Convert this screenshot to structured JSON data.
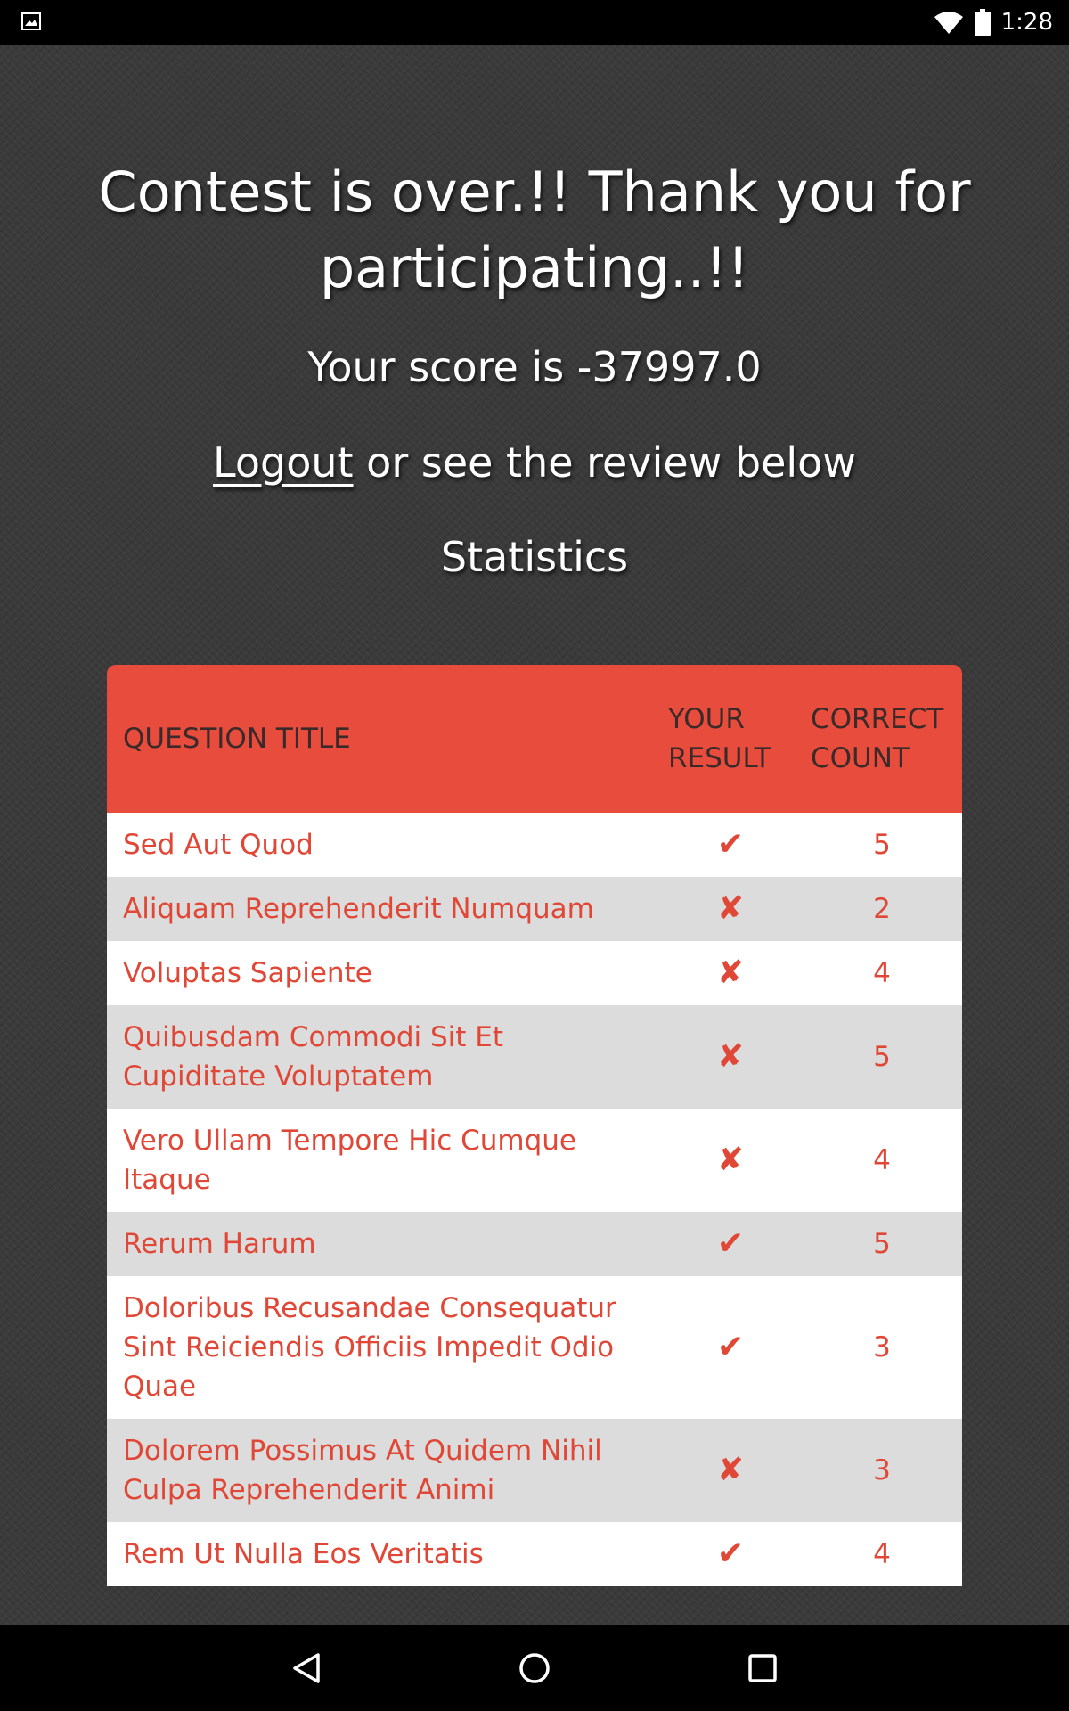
{
  "status_bar": {
    "time": "1:28",
    "left_icon": "image-icon",
    "icons": [
      "wifi-icon",
      "battery-icon"
    ]
  },
  "page": {
    "headline": "Contest is over.!! Thank you for participating..!!",
    "score_text": "Your score is -37997.0",
    "logout_label": "Logout",
    "review_text": " or see the review below",
    "statistics_title": "Statistics"
  },
  "table": {
    "headers": {
      "question_title": "QUESTION TITLE",
      "your_result": "YOUR RESULT",
      "correct_count": "CORRECT COUNT"
    },
    "rows": [
      {
        "title": "Sed Aut Quod",
        "result": "✔",
        "result_icon": "check-icon",
        "count": "5"
      },
      {
        "title": "Aliquam Reprehenderit Numquam",
        "result": "✘",
        "result_icon": "cross-icon",
        "count": "2"
      },
      {
        "title": "Voluptas Sapiente",
        "result": "✘",
        "result_icon": "cross-icon",
        "count": "4"
      },
      {
        "title": "Quibusdam Commodi Sit Et Cupiditate Voluptatem",
        "result": "✘",
        "result_icon": "cross-icon",
        "count": "5"
      },
      {
        "title": "Vero Ullam Tempore Hic Cumque Itaque",
        "result": "✘",
        "result_icon": "cross-icon",
        "count": "4"
      },
      {
        "title": "Rerum Harum",
        "result": "✔",
        "result_icon": "check-icon",
        "count": "5"
      },
      {
        "title": "Doloribus Recusandae Consequatur Sint Reiciendis Officiis Impedit Odio Quae",
        "result": "✔",
        "result_icon": "check-icon",
        "count": "3"
      },
      {
        "title": "Dolorem Possimus At Quidem Nihil Culpa Reprehenderit Animi",
        "result": "✘",
        "result_icon": "cross-icon",
        "count": "3"
      },
      {
        "title": "Rem Ut Nulla Eos Veritatis",
        "result": "✔",
        "result_icon": "check-icon",
        "count": "4"
      }
    ]
  },
  "nav_bar": {
    "buttons": [
      "back-icon",
      "home-icon",
      "recents-icon"
    ]
  },
  "colors": {
    "accent": "#e74c3c",
    "row_text": "#e14736",
    "background": "#3a3a3a"
  }
}
